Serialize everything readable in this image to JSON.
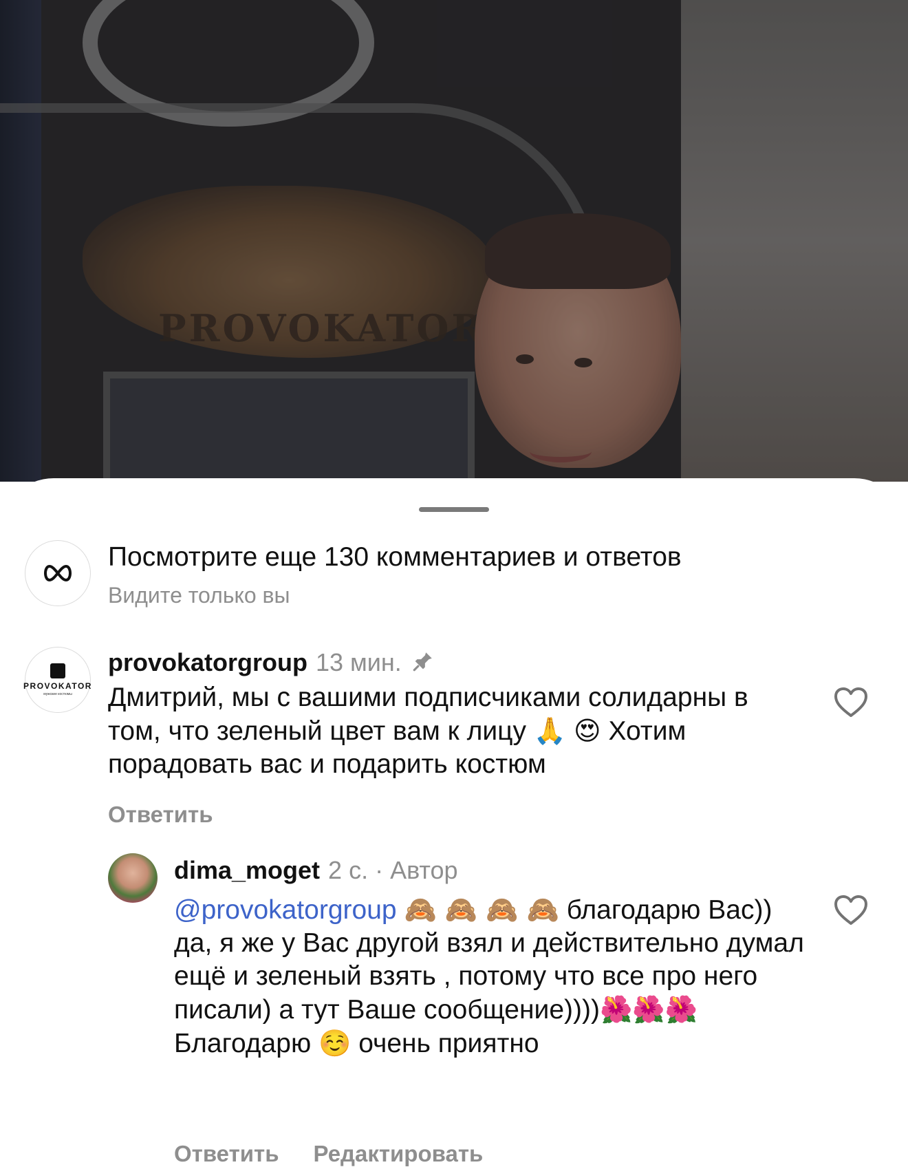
{
  "sheet": {
    "meta_notice": {
      "title": "Посмотрите еще 130 комментариев и ответов",
      "subtitle": "Видите только вы",
      "icon": "meta-infinity-icon"
    }
  },
  "background": {
    "sign_text": "PROVOKATOR"
  },
  "comments": [
    {
      "username": "provokatorgroup",
      "time": "13 мин.",
      "pinned": true,
      "avatar_logo_text": "PROVOKATOR",
      "avatar_logo_sub": "мужские костюмы",
      "text_1": "Дмитрий, мы с вашими подписчиками солидарны в том, что зеленый цвет вам к лицу",
      "emoji_1": "🙏",
      "emoji_2": "😍",
      "text_2": "Хотим порадовать вас и подарить костюм",
      "reply_label": "Ответить",
      "like_icon": "heart-icon"
    },
    {
      "username": "dima_moget",
      "time": "2 с. · Автор",
      "mention": "@provokatorgroup",
      "emoji_monkeys": "🙈 🙈 🙈 🙈",
      "text_1": "благодарю Вас)) да, я же у Вас другой взял и действительно думал ещё и зеленый взять , потому что все про него писали) а тут Ваше сообщение))))",
      "emoji_flowers": "🌺🌺🌺",
      "text_2": "Благодарю",
      "emoji_smile": "☺️",
      "text_3": "очень приятно",
      "reply_label": "Ответить",
      "edit_label": "Редактировать",
      "like_icon": "heart-icon"
    }
  ],
  "colors": {
    "mention": "#3d63c9",
    "secondary_text": "#8e8e8e"
  }
}
